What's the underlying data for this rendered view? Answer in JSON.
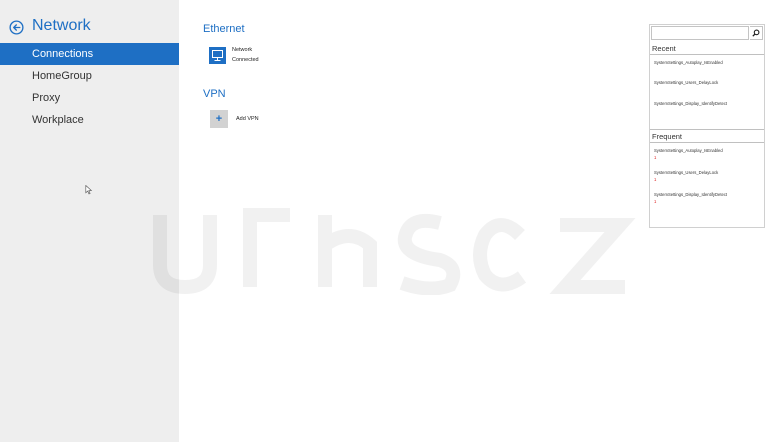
{
  "left_pane": {
    "title": "Network",
    "nav_items": [
      {
        "label": "Connections",
        "active": true
      },
      {
        "label": "HomeGroup",
        "active": false
      },
      {
        "label": "Proxy",
        "active": false
      },
      {
        "label": "Workplace",
        "active": false
      }
    ]
  },
  "main": {
    "ethernet": {
      "title": "Ethernet",
      "network_name": "Network",
      "network_status": "Connected"
    },
    "vpn": {
      "title": "VPN",
      "add_label": "Add VPN"
    }
  },
  "search_flyout": {
    "query": "",
    "recent_title": "Recent",
    "recent_items": [
      "SystemSettings_Autoplay_IsEnabled",
      "SystemSettings_Users_DelayLock",
      "SystemSettings_Display_IdentifyDetect"
    ],
    "frequent_title": "Frequent",
    "frequent_items": [
      {
        "name": "SystemSettings_Autoplay_IsEnabled",
        "count": "1"
      },
      {
        "name": "SystemSettings_Users_DelayLock",
        "count": "1"
      },
      {
        "name": "SystemSettings_Display_IdentifyDetect",
        "count": "1"
      }
    ]
  },
  "colors": {
    "accent": "#1e6fc4",
    "left_pane_bg": "#eeeeee",
    "count_red": "#dd2222"
  }
}
